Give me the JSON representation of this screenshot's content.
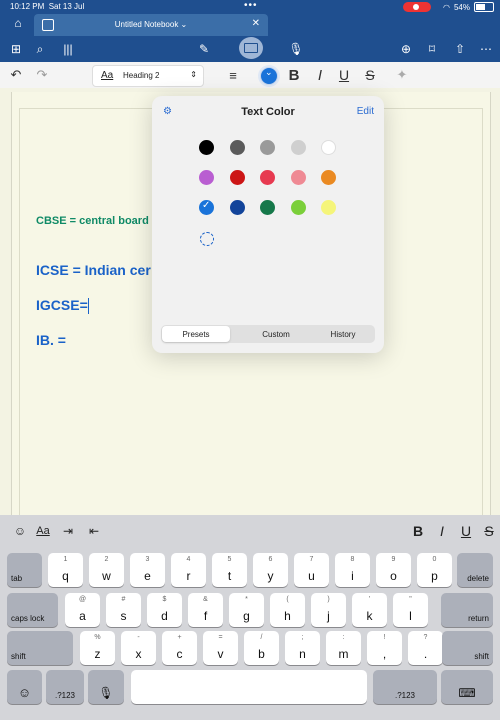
{
  "status_bar": {
    "time": "10:12 PM",
    "date": "Sat 13 Jul",
    "battery": "54%"
  },
  "tab": {
    "title": "Untitled Notebook"
  },
  "toolbar2": {
    "style_aa": "Aa",
    "style_name": "Heading 2"
  },
  "document": {
    "line1": "CBSE  = central board",
    "line2": "ICSE  = Indian cer",
    "line3": "IGCSE=",
    "line4": "IB. ="
  },
  "popover": {
    "title": "Text Color",
    "edit": "Edit",
    "tabs": [
      "Presets",
      "Custom",
      "History"
    ],
    "swatches": [
      [
        "#000000",
        "#5b5b5b",
        "#9a9a9a",
        "#cfcfcf",
        "#ffffff"
      ],
      [
        "#b95ed1",
        "#cc1515",
        "#e73a50",
        "#ef8a94",
        "#ea8a22"
      ],
      [
        "#1a73d9",
        "#12449a",
        "#16784a",
        "#7bcf3a",
        "#f5f57a"
      ]
    ],
    "selected": "#1a73d9"
  },
  "keyboard": {
    "toolbar_aa": "Aa",
    "row1": [
      [
        "1",
        "q"
      ],
      [
        "2",
        "w"
      ],
      [
        "3",
        "e"
      ],
      [
        "4",
        "r"
      ],
      [
        "5",
        "t"
      ],
      [
        "6",
        "y"
      ],
      [
        "7",
        "u"
      ],
      [
        "8",
        "i"
      ],
      [
        "9",
        "o"
      ],
      [
        "0",
        "p"
      ]
    ],
    "row2": [
      [
        "@",
        "a"
      ],
      [
        "#",
        "s"
      ],
      [
        "$",
        "d"
      ],
      [
        "&",
        "f"
      ],
      [
        "*",
        "g"
      ],
      [
        "(",
        "h"
      ],
      [
        ")",
        "j"
      ],
      [
        "'",
        "k"
      ],
      [
        "\"",
        "l"
      ]
    ],
    "row3": [
      [
        "%",
        "z"
      ],
      [
        "-",
        "x"
      ],
      [
        "+",
        "c"
      ],
      [
        "=",
        "v"
      ],
      [
        "/",
        "b"
      ],
      [
        ";",
        "n"
      ],
      [
        ":",
        "m"
      ],
      [
        "!",
        ","
      ],
      [
        "?",
        "."
      ]
    ],
    "tab": "tab",
    "delete": "delete",
    "caps_lock": "caps lock",
    "return": "return",
    "shift": "shift",
    "num_left": ".?123",
    "num_right": ".?123"
  }
}
